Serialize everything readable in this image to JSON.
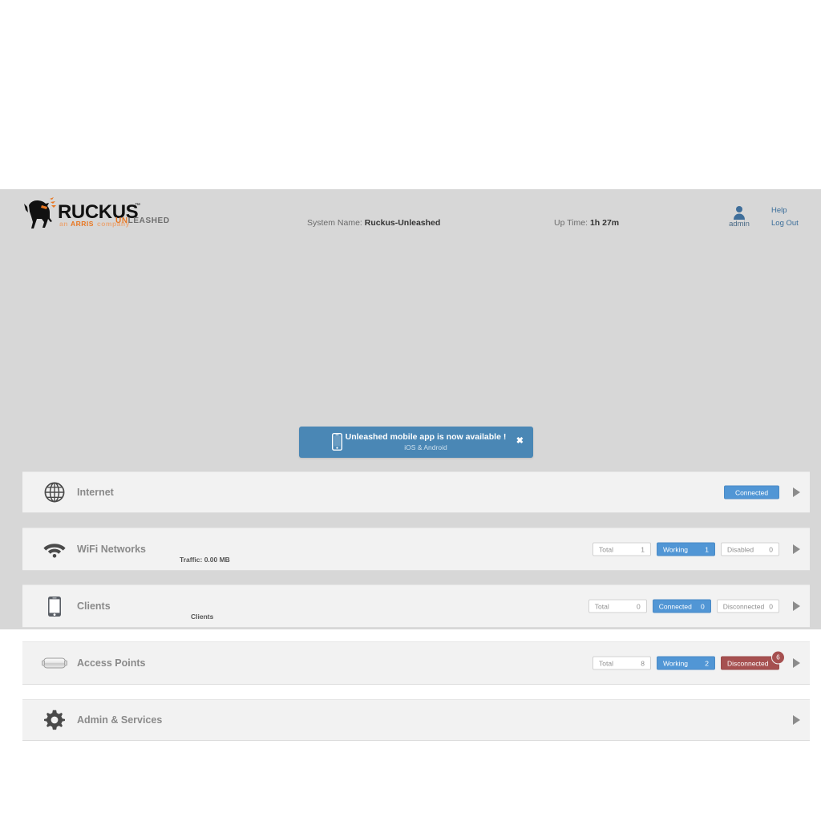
{
  "header": {
    "brand": "RUCKUS",
    "brand_tagline": "an ARRIS company",
    "unleashed_prefix": "UN",
    "unleashed_rest": "LEASHED",
    "system_name_label": "System Name:",
    "system_name_value": "Ruckus-Unleashed",
    "uptime_label": "Up Time:",
    "uptime_value": "1h 27m",
    "user_name": "admin",
    "help_label": "Help",
    "logout_label": "Log Out"
  },
  "banner": {
    "title": "Unleashed mobile app is now available !",
    "subtitle": "iOS & Android",
    "close_label": "✖"
  },
  "cards": [
    {
      "id": "internet",
      "title": "Internet",
      "icon": "globe-icon",
      "sub": "",
      "stats": [
        {
          "label": "Connected",
          "value": "",
          "style": "blue",
          "single": true
        }
      ]
    },
    {
      "id": "wifi-networks",
      "title": "WiFi Networks",
      "icon": "wifi-icon",
      "sub": "Traffic: 0.00 MB",
      "stats": [
        {
          "label": "Total",
          "value": "1",
          "style": "plain"
        },
        {
          "label": "Working",
          "value": "1",
          "style": "blue"
        },
        {
          "label": "Disabled",
          "value": "0",
          "style": "plain"
        }
      ]
    },
    {
      "id": "clients",
      "title": "Clients",
      "icon": "phone-icon",
      "sub": "Clients",
      "stats": [
        {
          "label": "Total",
          "value": "0",
          "style": "plain"
        },
        {
          "label": "Connected",
          "value": "0",
          "style": "blue"
        },
        {
          "label": "Disconnected",
          "value": "0",
          "style": "plain"
        }
      ]
    },
    {
      "id": "access-points",
      "title": "Access Points",
      "icon": "ap-icon",
      "sub": "",
      "stats": [
        {
          "label": "Total",
          "value": "8",
          "style": "plain"
        },
        {
          "label": "Working",
          "value": "2",
          "style": "blue"
        },
        {
          "label": "Disconnected",
          "value": "",
          "style": "red",
          "badge": "6"
        }
      ]
    },
    {
      "id": "admin-services",
      "title": "Admin & Services",
      "icon": "gear-icon",
      "sub": "",
      "stats": []
    }
  ],
  "colors": {
    "page_bg": "#d7d7d7",
    "card_bg": "#f2f2f2",
    "accent_blue": "#5196d5",
    "banner_blue": "#4a87b5",
    "alert_red": "#a65050",
    "brand_orange": "#e87722"
  }
}
